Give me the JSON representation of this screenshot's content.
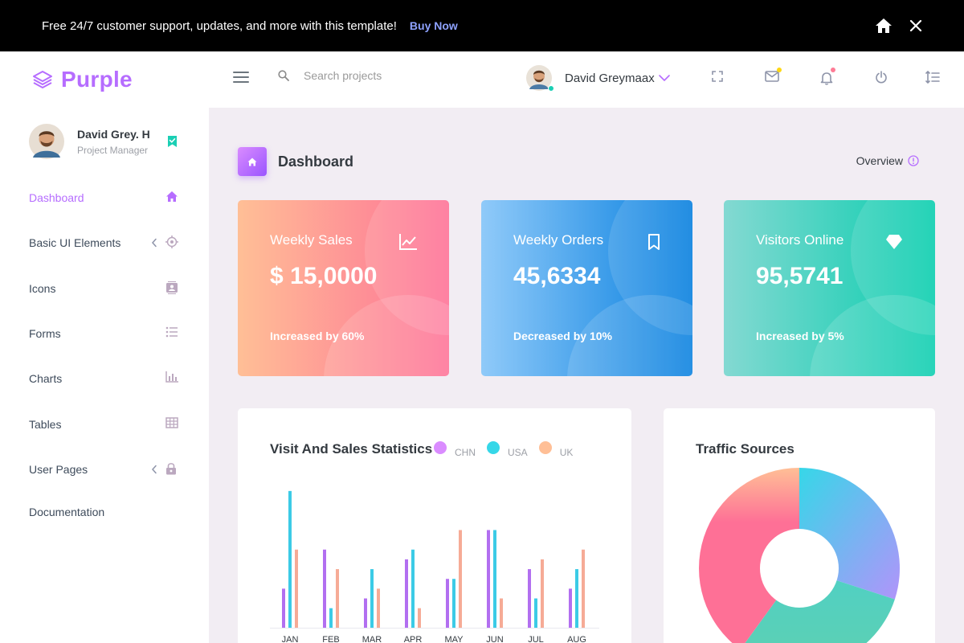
{
  "banner": {
    "text": "Free 24/7 customer support, updates, and more with this template!",
    "buy_label": "Buy Now"
  },
  "navbar": {
    "brand": "Purple",
    "search_placeholder": "Search projects",
    "user_name": "David Greymaax",
    "icons": [
      "fullscreen-icon",
      "mail-icon",
      "bell-icon",
      "power-icon",
      "list-icon"
    ]
  },
  "sidebar": {
    "profile": {
      "name": "David Grey. H",
      "role": "Project Manager"
    },
    "items": [
      {
        "label": "Dashboard",
        "icon": "home-icon",
        "active": true
      },
      {
        "label": "Basic UI Elements",
        "icon": "crosshairs-icon",
        "chevron": true
      },
      {
        "label": "Icons",
        "icon": "contacts-icon"
      },
      {
        "label": "Forms",
        "icon": "format-list-icon"
      },
      {
        "label": "Charts",
        "icon": "bar-chart-icon"
      },
      {
        "label": "Tables",
        "icon": "table-icon"
      },
      {
        "label": "User Pages",
        "icon": "lock-icon",
        "chevron": true
      },
      {
        "label": "Documentation",
        "icon": ""
      }
    ]
  },
  "page": {
    "title": "Dashboard",
    "overview_label": "Overview"
  },
  "stats": [
    {
      "title": "Weekly Sales",
      "value": "$ 15,0000",
      "note": "Increased by 60%",
      "icon": "chart-line-icon",
      "gradient": [
        "#ffbf96",
        "#fe7096"
      ]
    },
    {
      "title": "Weekly Orders",
      "value": "45,6334",
      "note": "Decreased by 10%",
      "icon": "bookmark-icon",
      "gradient": [
        "#90caf9",
        "#047edf"
      ]
    },
    {
      "title": "Visitors Online",
      "value": "95,5741",
      "note": "Increased by 5%",
      "icon": "diamond-icon",
      "gradient": [
        "#84d9d2",
        "#07cdae"
      ]
    }
  ],
  "visit_chart": {
    "title": "Visit And Sales Statistics",
    "legend": [
      {
        "label": "CHN",
        "color": "#da8cff"
      },
      {
        "label": "USA",
        "color": "#36d7e8"
      },
      {
        "label": "UK",
        "color": "#ffbf96"
      }
    ]
  },
  "traffic_chart": {
    "title": "Traffic Sources"
  },
  "chart_data": [
    {
      "type": "bar",
      "title": "Visit And Sales Statistics",
      "categories": [
        "JAN",
        "FEB",
        "MAR",
        "APR",
        "MAY",
        "JUN",
        "JUL",
        "AUG"
      ],
      "series": [
        {
          "name": "CHN",
          "color": "#b26ff0",
          "values": [
            20,
            40,
            15,
            35,
            25,
            50,
            30,
            20
          ]
        },
        {
          "name": "USA",
          "color": "#3ccbe6",
          "values": [
            70,
            10,
            30,
            40,
            25,
            50,
            15,
            30
          ]
        },
        {
          "name": "UK",
          "color": "#f6ab96",
          "values": [
            40,
            30,
            20,
            10,
            50,
            15,
            35,
            40
          ]
        }
      ],
      "ylim": [
        0,
        72
      ]
    },
    {
      "type": "pie",
      "title": "Traffic Sources",
      "values": [
        30,
        30,
        40
      ],
      "colors": [
        "#3fd0e6",
        "#4ecdc0",
        "#fe6f92"
      ],
      "donut": true
    }
  ]
}
